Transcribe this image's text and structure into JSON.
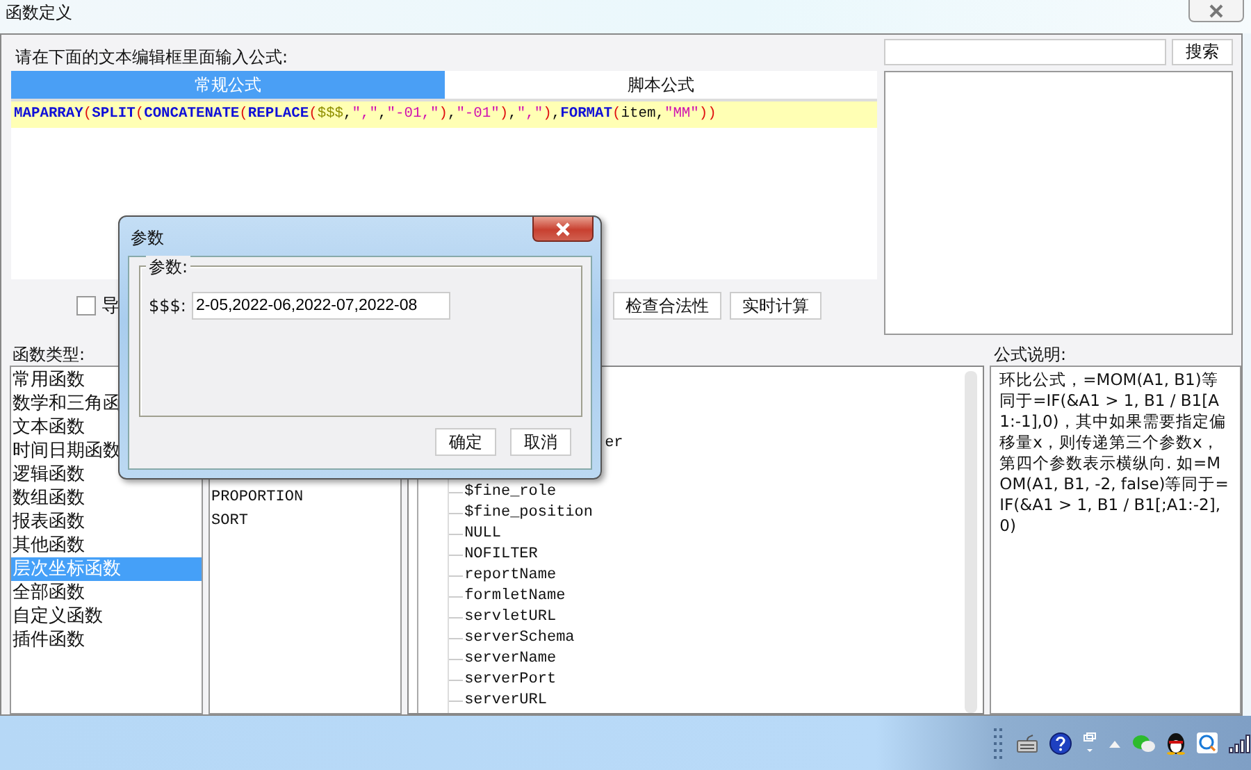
{
  "window": {
    "title": "函数定义"
  },
  "editor": {
    "prompt": "请在下面的文本编辑框里面输入公式:",
    "tabs": [
      {
        "label": "常规公式",
        "selected": true
      },
      {
        "label": "脚本公式",
        "selected": false
      }
    ],
    "formula": [
      {
        "kind": "func",
        "text": "MAPARRAY"
      },
      {
        "kind": "paren",
        "text": "("
      },
      {
        "kind": "func",
        "text": "SPLIT"
      },
      {
        "kind": "paren",
        "text": "("
      },
      {
        "kind": "func",
        "text": "CONCATENATE"
      },
      {
        "kind": "paren",
        "text": "("
      },
      {
        "kind": "func",
        "text": "REPLACE"
      },
      {
        "kind": "paren",
        "text": "("
      },
      {
        "kind": "var",
        "text": "$$$"
      },
      {
        "kind": "plain",
        "text": ","
      },
      {
        "kind": "str",
        "text": "\",\""
      },
      {
        "kind": "plain",
        "text": ","
      },
      {
        "kind": "str",
        "text": "\"-01,\""
      },
      {
        "kind": "paren",
        "text": ")"
      },
      {
        "kind": "plain",
        "text": ","
      },
      {
        "kind": "str",
        "text": "\"-01\""
      },
      {
        "kind": "paren",
        "text": ")"
      },
      {
        "kind": "plain",
        "text": ","
      },
      {
        "kind": "str",
        "text": "\",\""
      },
      {
        "kind": "paren",
        "text": ")"
      },
      {
        "kind": "plain",
        "text": ","
      },
      {
        "kind": "func",
        "text": "FORMAT"
      },
      {
        "kind": "paren",
        "text": "("
      },
      {
        "kind": "plain",
        "text": "item,"
      },
      {
        "kind": "str",
        "text": "\"MM\""
      },
      {
        "kind": "paren",
        "text": "))"
      }
    ]
  },
  "search": {
    "button": "搜索"
  },
  "export_checkbox": {
    "label": "导",
    "checked": false
  },
  "buttons": [
    "检查合法性",
    "实时计算"
  ],
  "function_types": {
    "label": "函数类型:",
    "items": [
      {
        "text": "常用函数",
        "selected": false
      },
      {
        "text": "数学和三角函",
        "selected": false
      },
      {
        "text": "文本函数",
        "selected": false
      },
      {
        "text": "时间日期函数",
        "selected": false
      },
      {
        "text": "逻辑函数",
        "selected": false
      },
      {
        "text": "数组函数",
        "selected": false
      },
      {
        "text": "报表函数",
        "selected": false
      },
      {
        "text": "其他函数",
        "selected": false
      },
      {
        "text": "层次坐标函数",
        "selected": true
      },
      {
        "text": "全部函数",
        "selected": false
      },
      {
        "text": "自定义函数",
        "selected": false
      },
      {
        "text": "插件函数",
        "selected": false
      }
    ]
  },
  "function_names": {
    "items": [
      {
        "text": "PROPORTION",
        "selected": false
      },
      {
        "text": "SORT",
        "selected": false
      }
    ]
  },
  "tree": {
    "items": [
      {
        "kind": "tail",
        "text": "er"
      },
      {
        "kind": "leaf",
        "text": "$fine_role"
      },
      {
        "kind": "leaf",
        "text": "$fine_position"
      },
      {
        "kind": "leaf",
        "text": "NULL"
      },
      {
        "kind": "leaf",
        "text": "NOFILTER"
      },
      {
        "kind": "leaf",
        "text": "reportName"
      },
      {
        "kind": "leaf",
        "text": "formletName"
      },
      {
        "kind": "leaf",
        "text": "servletURL"
      },
      {
        "kind": "leaf",
        "text": "serverSchema"
      },
      {
        "kind": "leaf",
        "text": "serverName"
      },
      {
        "kind": "leaf",
        "text": "serverPort"
      },
      {
        "kind": "leaf",
        "text": "serverURL"
      }
    ]
  },
  "description": {
    "label": "公式说明:",
    "text": "环比公式，=MOM(A1, B1)等同于=IF(&A1 > 1, B1 / B1[A1:-1],0)，其中如果需要指定偏移量x，则传递第三个参数x，第四个参数表示横纵向. 如=MOM(A1, B1, -2, false)等同于=IF(&A1 > 1, B1 / B1[;A1:-2], 0)"
  },
  "param_dialog": {
    "title": "参数",
    "group": "参数:",
    "params": [
      {
        "name": "$$$:",
        "value": "2-05,2022-06,2022-07,2022-08"
      }
    ],
    "buttons": [
      "确定",
      "取消"
    ]
  }
}
